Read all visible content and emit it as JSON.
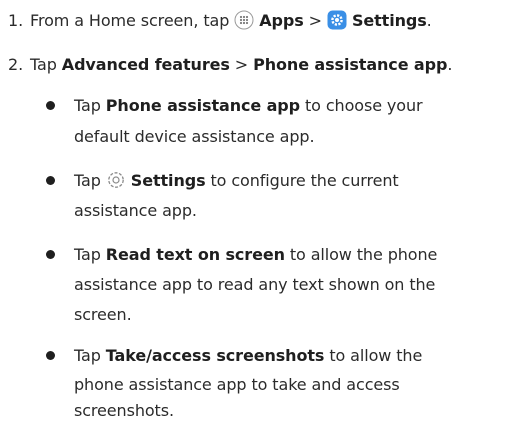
{
  "steps": [
    {
      "number": "1.",
      "pre": "From a Home screen, tap ",
      "apps_label": "Apps",
      "sep": " > ",
      "settings_label": "Settings",
      "end": "."
    },
    {
      "number": "2.",
      "pre": "Tap ",
      "a": "Advanced features",
      "sep": " > ",
      "b": "Phone assistance app",
      "end": "."
    }
  ],
  "bullets": [
    {
      "pre": "Tap ",
      "bold": "Phone assistance app",
      "line1_rest": " to choose your",
      "line2": "default device assistance app."
    },
    {
      "pre": "Tap ",
      "bold": "Settings",
      "line1_rest": " to configure the current",
      "line2": "assistance app."
    },
    {
      "pre": "Tap ",
      "bold": "Read text on screen",
      "line1_rest": " to allow the phone",
      "line2": "assistance app to read any text shown on the",
      "line3": "screen."
    },
    {
      "pre": "Tap ",
      "bold": "Take/access screenshots",
      "line1_rest": " to allow the",
      "line2": "phone assistance app to take and access",
      "line3": "screenshots."
    }
  ],
  "icons": {
    "apps": "apps-grid-icon",
    "settings_filled": "settings-gear-filled-icon",
    "settings_outline": "settings-gear-outline-icon",
    "accent_color": "#3a8fe6"
  }
}
